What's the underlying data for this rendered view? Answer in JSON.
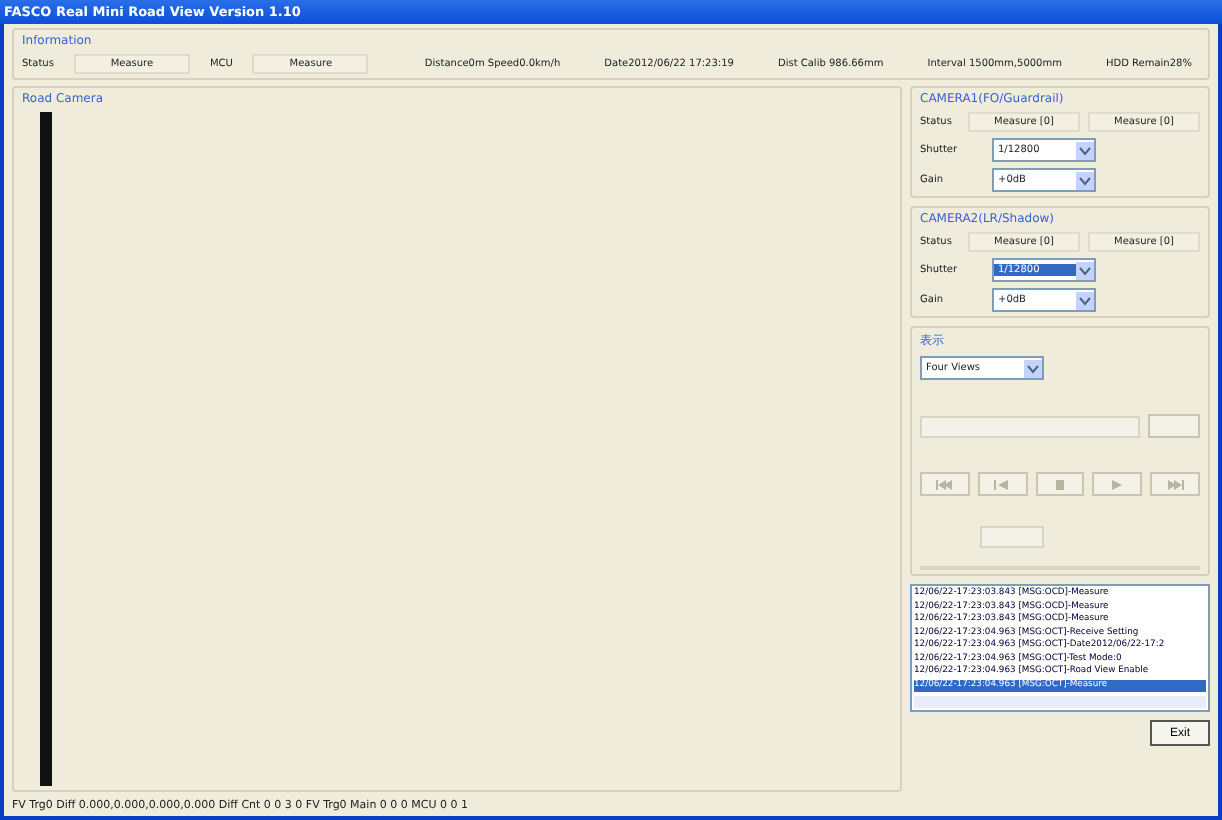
{
  "window": {
    "title": "FASCO Real Mini Road View Version 1.10"
  },
  "information": {
    "title": "Information",
    "fields": [
      {
        "label": "Status",
        "value": "Measure"
      },
      {
        "label": "MCU",
        "value": "Measure"
      }
    ],
    "readouts": [
      "Distance0m Speed0.0km/h",
      "Date2012/06/22 17:23:19",
      "Dist Calib 986.66mm",
      "Interval 1500mm,5000mm",
      "HDD Remain28%"
    ]
  },
  "road_camera": {
    "title": "Road Camera"
  },
  "cameras": [
    {
      "title": "CAMERA1(FO/Guardrail)",
      "status_label": "Status",
      "status": [
        "Measure [0]",
        "Measure [0]"
      ],
      "shutter_label": "Shutter",
      "shutter": "1/12800",
      "shutter_highlighted": false,
      "gain_label": "Gain",
      "gain": "+0dB"
    },
    {
      "title": "CAMERA2(LR/Shadow)",
      "status_label": "Status",
      "status": [
        "Measure [0]",
        "Measure [0]"
      ],
      "shutter_label": "Shutter",
      "shutter": "1/12800",
      "shutter_highlighted": true,
      "gain_label": "Gain",
      "gain": "+0dB"
    }
  ],
  "display": {
    "title": "表示",
    "view": "Four Views"
  },
  "log": [
    {
      "text": "12/06/22-17:23:03.843 [MSG:OCD]-Measure",
      "selected": false
    },
    {
      "text": "12/06/22-17:23:03.843 [MSG:OCD]-Measure",
      "selected": false
    },
    {
      "text": "12/06/22-17:23:03.843 [MSG:OCD]-Measure",
      "selected": false
    },
    {
      "text": "12/06/22-17:23:04.963 [MSG:OCT]-Receive Setting",
      "selected": false
    },
    {
      "text": "12/06/22-17:23:04.963 [MSG:OCT]-Date2012/06/22-17:2",
      "selected": false
    },
    {
      "text": "12/06/22-17:23:04.963 [MSG:OCT]-Test Mode:0",
      "selected": false
    },
    {
      "text": "12/06/22-17:23:04.963 [MSG:OCT]-Road View Enable",
      "selected": false
    },
    {
      "text": "12/06/22-17:23:04.963 [MSG:OCT]-Measure",
      "selected": true
    }
  ],
  "status_bar": "FV Trg0 Diff 0.000,0.000,0.000,0.000 Diff Cnt 0 0 3 0 FV Trg0 Main 0 0 0 MCU 0 0 1",
  "exit_button": "Exit"
}
